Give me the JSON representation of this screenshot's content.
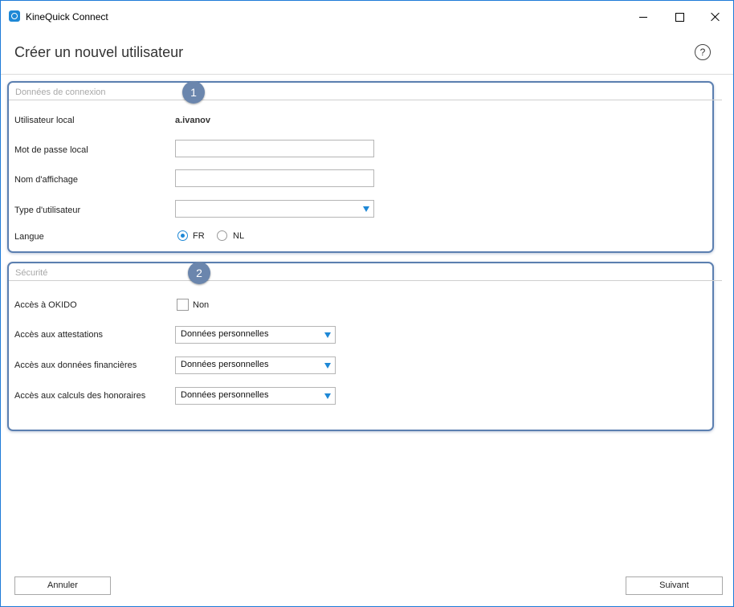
{
  "window": {
    "title": "KineQuick Connect",
    "accent": "#1e88d6",
    "section_border": "#5b7fb0",
    "marker_color": "#6b86ad"
  },
  "header": {
    "page_title": "Créer un nouvel utilisateur",
    "help_symbol": "?"
  },
  "section_connexion": {
    "title": "Données de connexion",
    "marker": "1",
    "local_user_label": "Utilisateur local",
    "local_user_value": "a.ivanov",
    "password_label": "Mot de passe local",
    "password_value": "",
    "display_name_label": "Nom d'affichage",
    "display_name_value": "",
    "user_type_label": "Type d'utilisateur",
    "user_type_value": "",
    "language_label": "Langue",
    "language_options": [
      "FR",
      "NL"
    ],
    "language_selected": "FR"
  },
  "section_securite": {
    "title": "Sécurité",
    "marker": "2",
    "okido_label": "Accès à OKIDO",
    "okido_checkbox_label": "Non",
    "okido_checked": false,
    "attestations_label": "Accès aux attestations",
    "attestations_value": "Données personnelles",
    "financial_label": "Accès aux données financières",
    "financial_value": "Données personnelles",
    "fees_label": "Accès aux calculs des honoraires",
    "fees_value": "Données personnelles"
  },
  "footer": {
    "cancel_label": "Annuler",
    "next_label": "Suivant"
  }
}
